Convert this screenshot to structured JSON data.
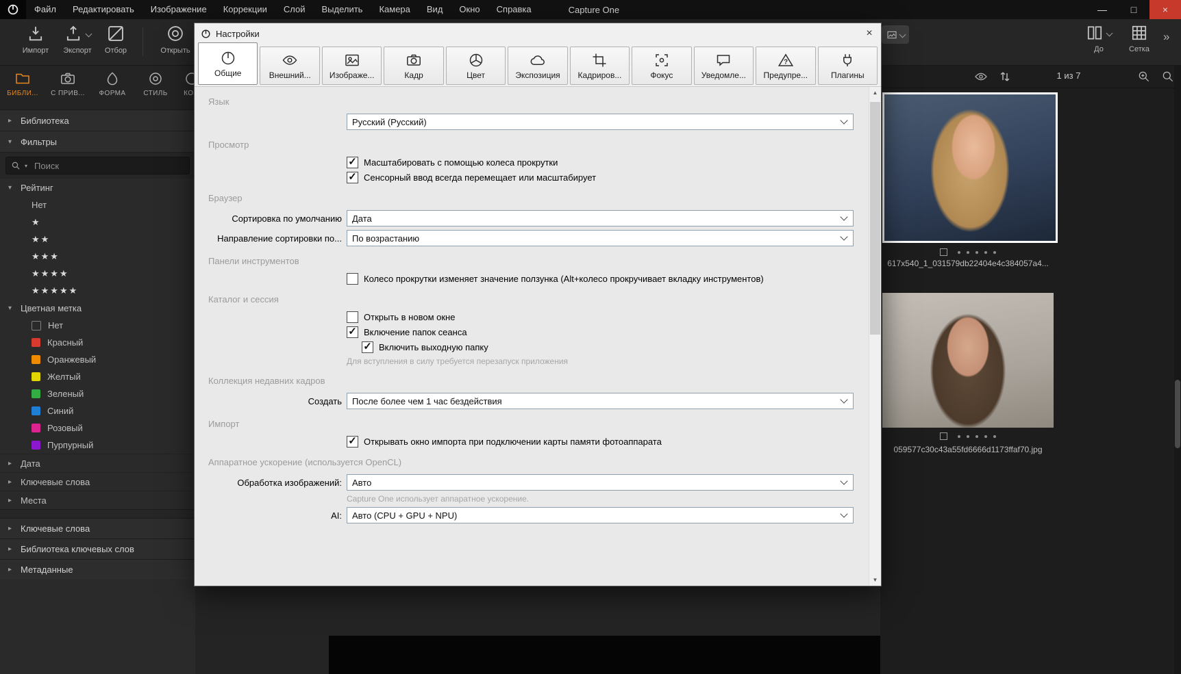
{
  "colors": {
    "accent_orange": "#e8871e",
    "close_button_red": "#c7392b",
    "selection_border": "#ffffff"
  },
  "menubar": {
    "items": [
      "Файл",
      "Редактировать",
      "Изображение",
      "Коррекции",
      "Слой",
      "Выделить",
      "Камера",
      "Вид",
      "Окно",
      "Справка"
    ],
    "app_title": "Capture One",
    "minimize": "—",
    "maximize": "□",
    "close": "×"
  },
  "toolbar": {
    "import": "Импорт",
    "export": "Экспорт",
    "cull": "Отбор",
    "open": "Открыть",
    "proof_label": "До",
    "grid_label": "Сетка",
    "more_chevron": "»"
  },
  "sidebar": {
    "tabs": [
      {
        "label": "БИБЛИ...",
        "icon": "folder-icon",
        "active": true
      },
      {
        "label": "С ПРИВ...",
        "icon": "camera-icon",
        "active": false
      },
      {
        "label": "ФОРМА",
        "icon": "lens-drop-icon",
        "active": false
      },
      {
        "label": "СТИЛЬ",
        "icon": "lens-filter-icon",
        "active": false
      },
      {
        "label": "КО...",
        "icon": "circle-icon",
        "active": false
      }
    ],
    "library_header": "Библиотека",
    "filters_header": "Фильтры",
    "search_placeholder": "Поиск",
    "rating": {
      "header": "Рейтинг",
      "items": [
        "Нет",
        "★",
        "★★",
        "★★★",
        "★★★★",
        "★★★★★"
      ]
    },
    "color_tag": {
      "header": "Цветная метка",
      "items": [
        {
          "label": "Нет",
          "color": ""
        },
        {
          "label": "Красный",
          "color": "#d93a2f"
        },
        {
          "label": "Оранжевый",
          "color": "#ef8b00"
        },
        {
          "label": "Желтый",
          "color": "#e3d600"
        },
        {
          "label": "Зеленый",
          "color": "#33ad43"
        },
        {
          "label": "Синий",
          "color": "#1f7fd4"
        },
        {
          "label": "Розовый",
          "color": "#dd2390"
        },
        {
          "label": "Пурпурный",
          "color": "#8b17cf"
        }
      ]
    },
    "collapsed_items": [
      "Дата",
      "Ключевые слова",
      "Места"
    ],
    "panel_headers": [
      "Ключевые слова",
      "Библиотека ключевых слов",
      "Метаданные"
    ]
  },
  "dialog": {
    "title": "Настройки",
    "tabs": [
      {
        "label": "Общие",
        "icon": "capture-one-logo-icon",
        "active": true
      },
      {
        "label": "Внешний...",
        "icon": "eye-icon",
        "active": false
      },
      {
        "label": "Изображе...",
        "icon": "image-icon",
        "active": false
      },
      {
        "label": "Кадр",
        "icon": "camera-icon",
        "active": false
      },
      {
        "label": "Цвет",
        "icon": "color-wheel-icon",
        "active": false
      },
      {
        "label": "Экспозиция",
        "icon": "cloud-icon",
        "active": false
      },
      {
        "label": "Кадриров...",
        "icon": "crop-icon",
        "active": false
      },
      {
        "label": "Фокус",
        "icon": "focus-icon",
        "active": false
      },
      {
        "label": "Уведомле...",
        "icon": "speech-bubble-icon",
        "active": false
      },
      {
        "label": "Предупре...",
        "icon": "warning-icon",
        "active": false
      },
      {
        "label": "Плагины",
        "icon": "plug-icon",
        "active": false
      }
    ],
    "sections": {
      "language": {
        "header": "Язык",
        "value": "Русский (Русский)"
      },
      "view": {
        "header": "Просмотр",
        "check1": {
          "label": "Масштабировать с помощью колеса прокрутки",
          "checked": true
        },
        "check2": {
          "label": "Сенсорный ввод всегда перемещает или масштабирует",
          "checked": true
        }
      },
      "browser": {
        "header": "Браузер",
        "row1": {
          "label": "Сортировка по умолчанию",
          "value": "Дата"
        },
        "row2": {
          "label": "Направление сортировки по...",
          "value": "По возрастанию"
        }
      },
      "toolbars": {
        "header": "Панели инструментов",
        "check1": {
          "label": "Колесо прокрутки изменяет значение ползунка (Alt+колесо прокручивает вкладку инструментов)",
          "checked": false
        }
      },
      "catalog": {
        "header": "Каталог и сессия",
        "check1": {
          "label": "Открыть в новом окне",
          "checked": false
        },
        "check2": {
          "label": "Включение папок сеанса",
          "checked": true
        },
        "check3": {
          "label": "Включить выходную папку",
          "checked": true
        },
        "note": "Для вступления в силу требуется перезапуск приложения"
      },
      "recent": {
        "header": "Коллекция недавних кадров",
        "row1": {
          "label": "Создать",
          "value": "После более чем 1 час бездействия"
        }
      },
      "import": {
        "header": "Импорт",
        "check1": {
          "label": "Открывать окно импорта при подключении карты памяти фотоаппарата",
          "checked": true
        }
      },
      "hardware": {
        "header": "Аппаратное ускорение (используется OpenCL)",
        "row1": {
          "label": "Обработка изображений:",
          "value": "Авто"
        },
        "note": "Capture One использует аппаратное ускорение.",
        "row2": {
          "label": "AI:",
          "value": "Авто (CPU + GPU + NPU)"
        }
      }
    }
  },
  "browser_panel": {
    "counter": "1 из 7",
    "thumbnails": [
      {
        "filename": "617x540_1_031579db22404e4c384057a4...",
        "selected": true
      },
      {
        "filename": "059577c30c43a55fd6666d1173ffaf70.jpg",
        "selected": false
      },
      {
        "filename": "",
        "selected": false
      }
    ]
  }
}
